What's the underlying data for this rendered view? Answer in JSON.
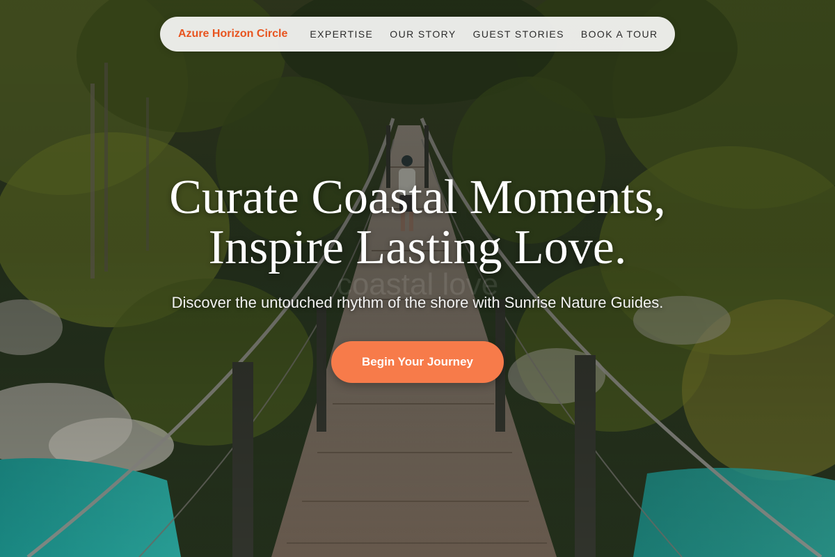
{
  "nav": {
    "brand": "Azure Horizon Circle",
    "links": [
      "EXPERTISE",
      "OUR STORY",
      "GUEST STORIES",
      "BOOK A TOUR"
    ]
  },
  "hero": {
    "title_line1": "Curate Coastal Moments,",
    "title_line2": "Inspire Lasting Love.",
    "ghost_text": "coastal love",
    "subtitle": "Discover the untouched rhythm of the shore with Sunrise Nature Guides.",
    "cta_label": "Begin Your Journey"
  },
  "colors": {
    "brand_accent": "#e8541f",
    "cta_background": "#f77b4a",
    "navbar_background": "#f3f3f1",
    "title_text": "#ffffff"
  },
  "background_image": "forest suspension bridge over turquoise river"
}
